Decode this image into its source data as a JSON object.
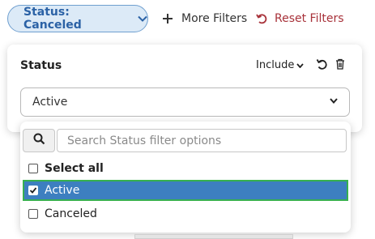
{
  "filter_bar": {
    "status_chip_label": "Status: Canceled",
    "more_filters_label": "More Filters",
    "reset_filters_label": "Reset Filters"
  },
  "panel": {
    "title": "Status",
    "mode": "Include",
    "selected_value": "Active"
  },
  "dropdown": {
    "search_placeholder": "Search Status filter options",
    "options": [
      {
        "label": "Select all",
        "checked": false
      },
      {
        "label": "Active",
        "checked": true
      },
      {
        "label": "Canceled",
        "checked": false
      }
    ]
  },
  "colors": {
    "chip_text": "#2b62a6",
    "chip_bg": "#dceaf7",
    "reset": "#a8323a",
    "highlight": "#3d7fc0",
    "focus_ring": "#37b04f"
  }
}
